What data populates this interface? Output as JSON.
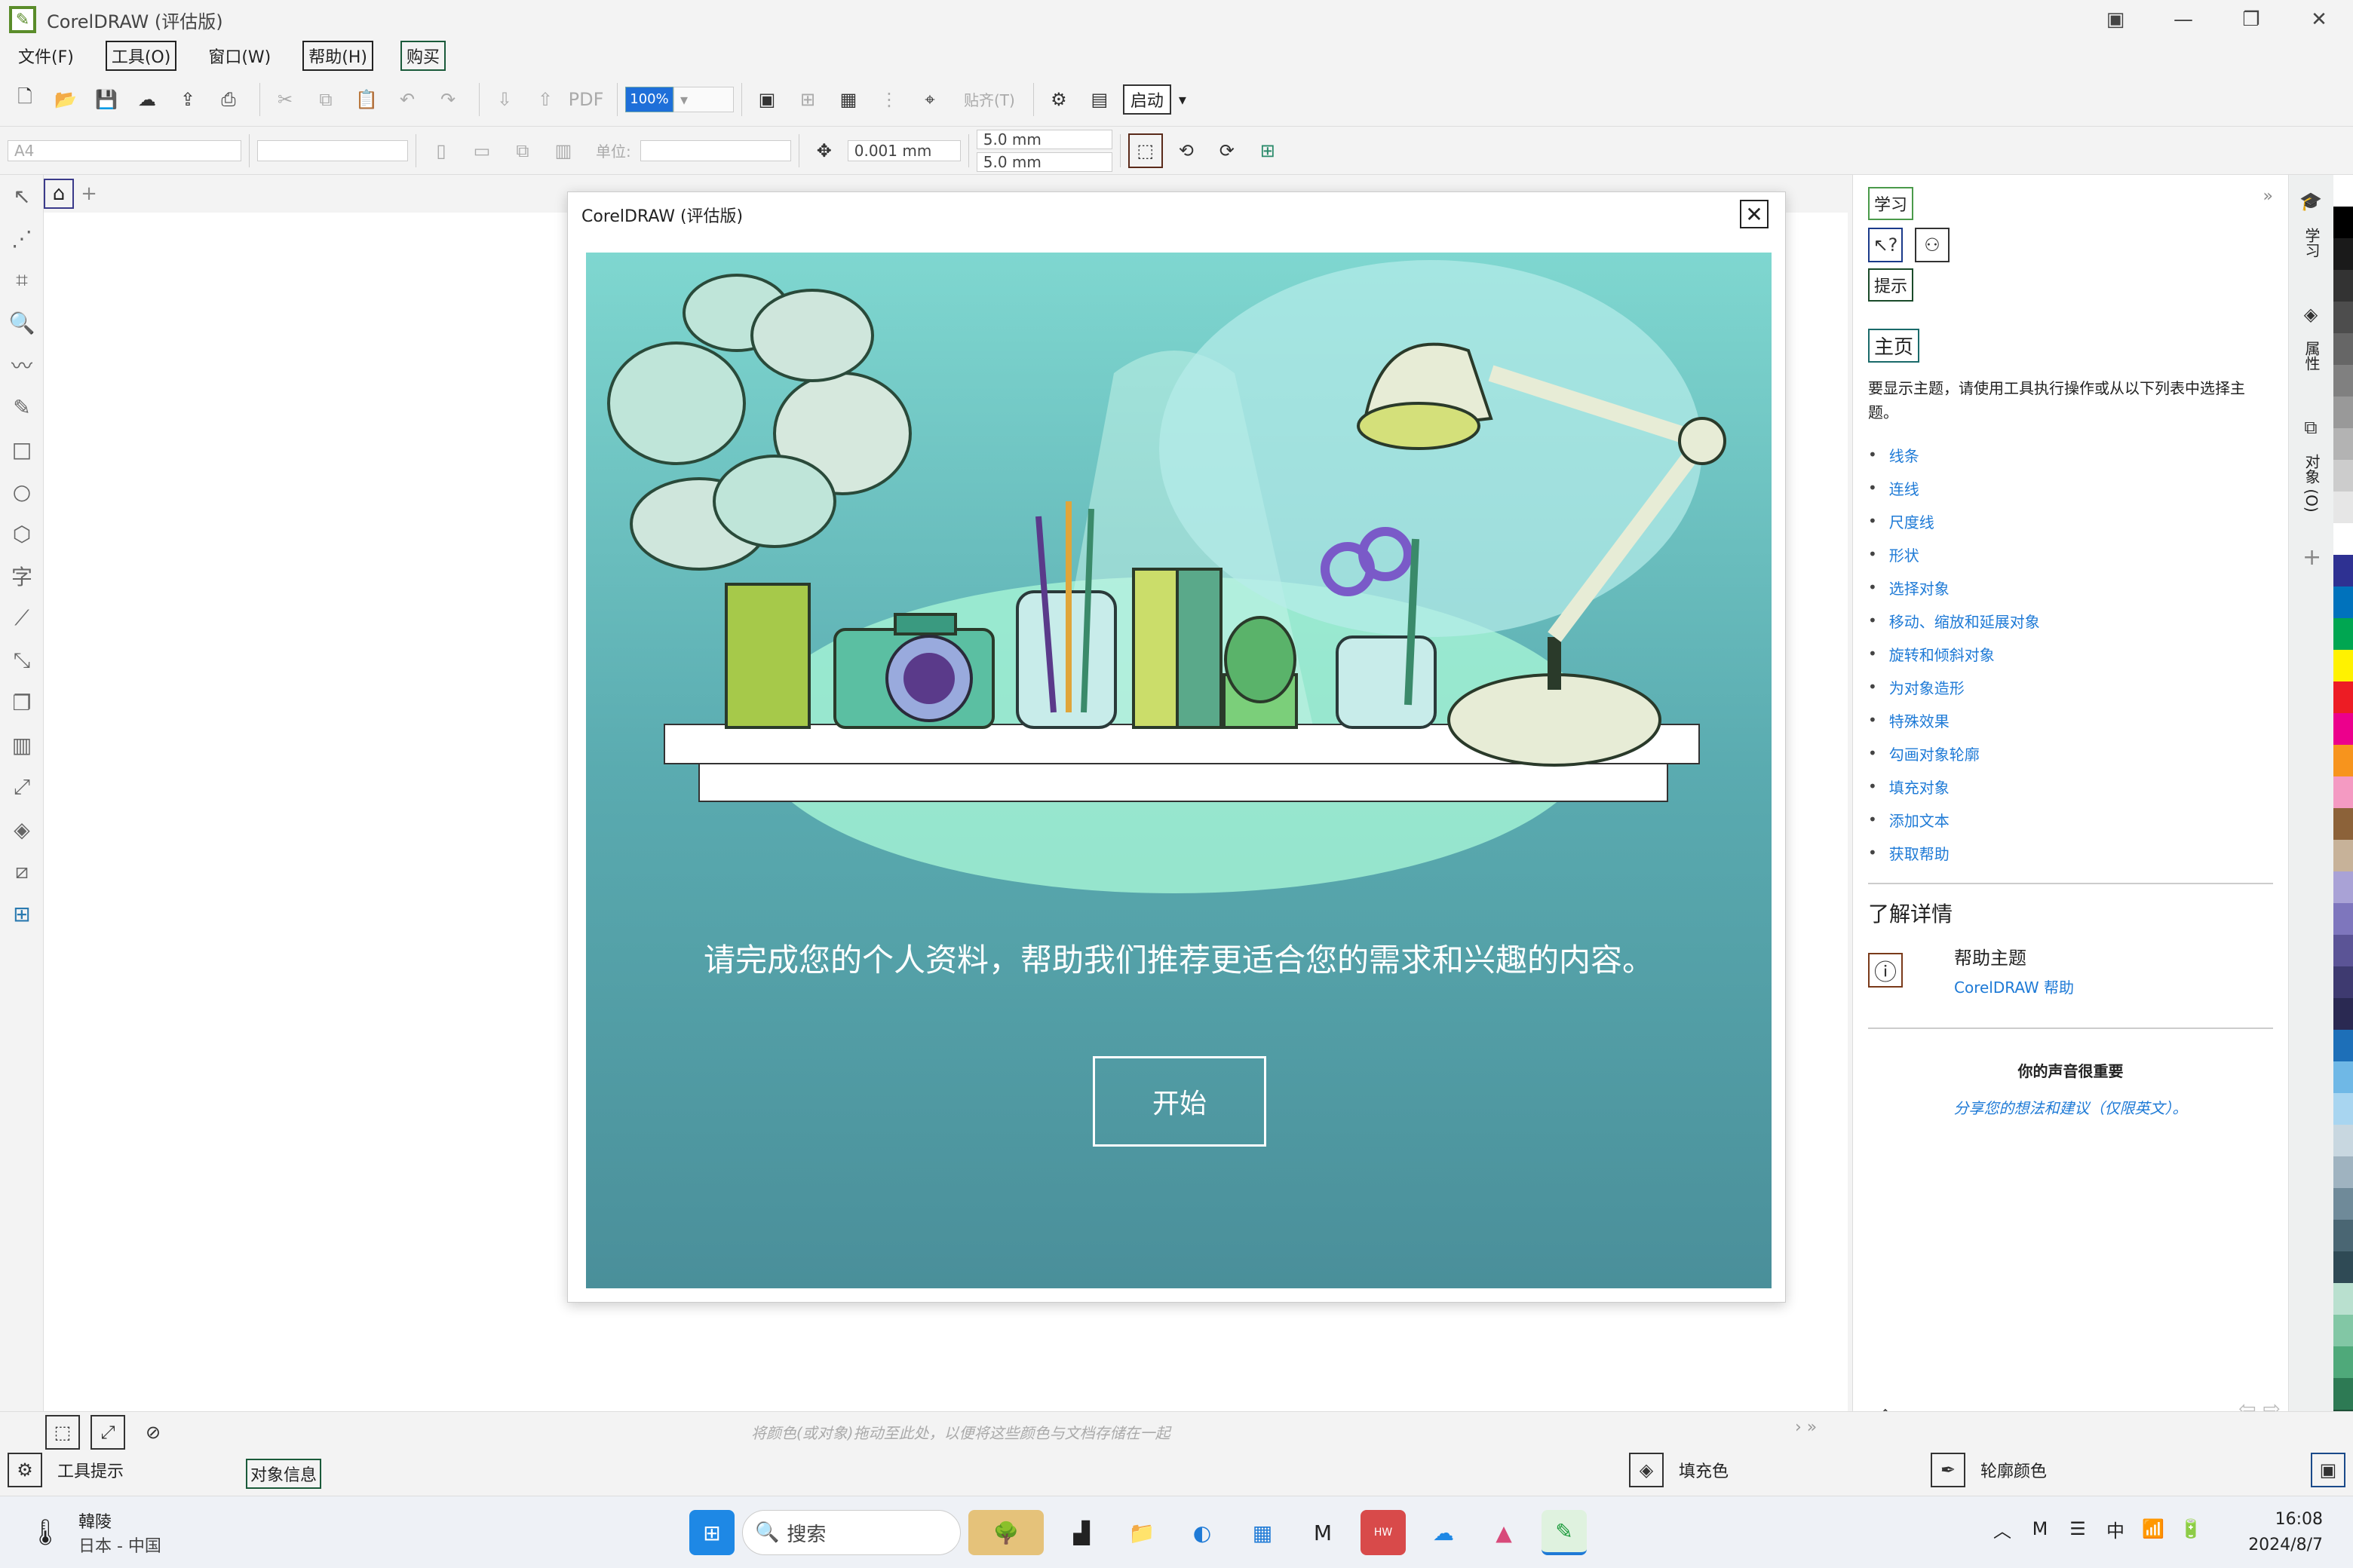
{
  "window": {
    "title": "CorelDRAW (评估版)"
  },
  "menu": {
    "file": "文件(F)",
    "tools": "工具(O)",
    "window": "窗口(W)",
    "help": "帮助(H)",
    "buy": "购买"
  },
  "toolbar": {
    "zoom_value": "100%",
    "paste_label": "贴齐(T)",
    "start_label": "启动"
  },
  "propbar": {
    "page_size": "A4",
    "units_label": "单位:",
    "nudge": "0.001 mm",
    "dup_x": "5.0 mm",
    "dup_y": "5.0 mm"
  },
  "dialog": {
    "title": "CorelDRAW (评估版)",
    "message": "请完成您的个人资料，帮助我们推荐更适合您的需求和兴趣的内容。",
    "start_button": "开始"
  },
  "right_panel": {
    "learn_tab": "学习",
    "hints_tab": "提示",
    "home_label": "主页",
    "description": "要显示主题，请使用工具执行操作或从以下列表中选择主题。",
    "topics": [
      "线条",
      "连线",
      "尺度线",
      "形状",
      "选择对象",
      "移动、缩放和延展对象",
      "旋转和倾斜对象",
      "为对象造形",
      "特殊效果",
      "勾画对象轮廓",
      "填充对象",
      "添加文本",
      "获取帮助"
    ],
    "learn_more": "了解详情",
    "help_topics_title": "帮助主题",
    "help_topics_link": "CorelDRAW 帮助",
    "feedback_title": "你的声音很重要",
    "feedback_link": "分享您的想法和建议（仅限英文）。"
  },
  "side_tabs": {
    "learn": "学习",
    "props": "属性",
    "objects": "对象 (O)"
  },
  "statusbar": {
    "drop_hint": "将颜色(或对象)拖动至此处，以便将这些颜色与文档存储在一起",
    "tool_tips": "工具提示",
    "object_info": "对象信息",
    "fill_color": "填充色",
    "outline_color": "轮廓颜色"
  },
  "taskbar": {
    "search_placeholder": "搜索",
    "weather": "韓陵",
    "locale": "日本 - 中国",
    "time": "16:08",
    "date": "2024/8/7",
    "ime": "中"
  },
  "palette_colors": [
    "#ffffff",
    "#000000",
    "#1a1a1a",
    "#333333",
    "#4d4d4d",
    "#666666",
    "#808080",
    "#999999",
    "#b3b3b3",
    "#cccccc",
    "#e6e6e6",
    "#ffffff",
    "#2e3192",
    "#0072bc",
    "#00a651",
    "#fff200",
    "#ed1c24",
    "#ec008c",
    "#f7941d",
    "#f49ac2",
    "#8c6239",
    "#c7b299",
    "#a9a2d6",
    "#7e76bd",
    "#5b5496",
    "#3e3a70",
    "#2a2952",
    "#1d6fb8",
    "#6fb8e6",
    "#a8d5f0",
    "#c8d7e0",
    "#9fb3c0",
    "#6f8a99",
    "#4a6673",
    "#2f4a55",
    "#b9e0cf",
    "#82c7a5",
    "#4fa97a",
    "#2d7a54",
    "#1c4f36"
  ]
}
